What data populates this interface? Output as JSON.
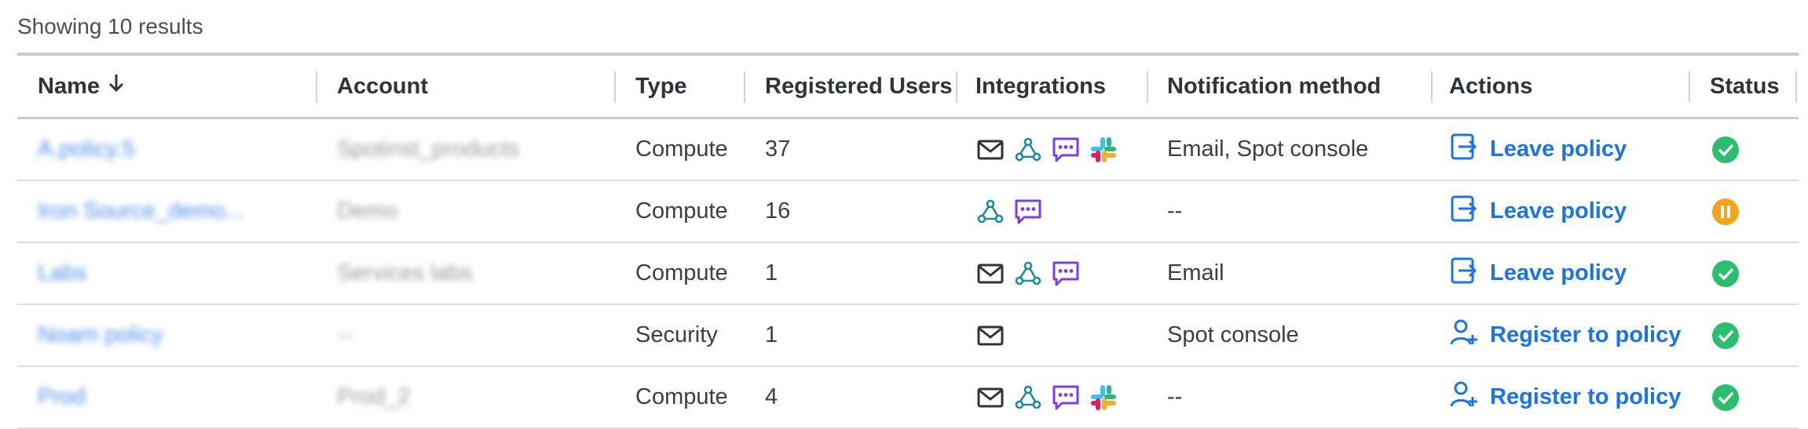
{
  "results_label": "Showing 10 results",
  "columns": {
    "name": "Name",
    "account": "Account",
    "type": "Type",
    "registered_users": "Registered Users",
    "integrations": "Integrations",
    "notification": "Notification method",
    "actions": "Actions",
    "status": "Status"
  },
  "rows": [
    {
      "name": "A.policy.5",
      "account": "Spotinst_products",
      "type": "Compute",
      "users": "37",
      "integrations": [
        "mail-icon",
        "webhook-icon",
        "chat-icon",
        "slack-icon"
      ],
      "notification": "Email, Spot console",
      "action": "Leave policy",
      "action_icon": "leave-icon",
      "status": "active",
      "status_color": "#2dbd6e"
    },
    {
      "name": "Iron Source_demo...",
      "account": "Demo",
      "type": "Compute",
      "users": "16",
      "integrations": [
        "webhook-icon",
        "chat-icon"
      ],
      "notification": "--",
      "action": "Leave policy",
      "action_icon": "leave-icon",
      "status": "paused",
      "status_color": "#f4a31c"
    },
    {
      "name": "Labs",
      "account": "Services labs",
      "type": "Compute",
      "users": "1",
      "integrations": [
        "mail-icon",
        "webhook-icon",
        "chat-icon"
      ],
      "notification": "Email",
      "action": "Leave policy",
      "action_icon": "leave-icon",
      "status": "active",
      "status_color": "#2dbd6e"
    },
    {
      "name": "Noam policy",
      "account": "--",
      "type": "Security",
      "users": "1",
      "integrations": [
        "mail-icon"
      ],
      "notification": "Spot console",
      "action": "Register to policy",
      "action_icon": "register-icon",
      "status": "active",
      "status_color": "#2dbd6e"
    },
    {
      "name": "Prod",
      "account": "Prod_2",
      "type": "Compute",
      "users": "4",
      "integrations": [
        "mail-icon",
        "webhook-icon",
        "chat-icon",
        "slack-icon"
      ],
      "notification": "--",
      "action": "Register to policy",
      "action_icon": "register-icon",
      "status": "active",
      "status_color": "#2dbd6e"
    }
  ],
  "colors": {
    "link": "#1a73e8",
    "active": "#2dbd6e",
    "paused": "#f4a31c",
    "chat": "#7b3fe4",
    "webhook": "#1f8a9c"
  }
}
